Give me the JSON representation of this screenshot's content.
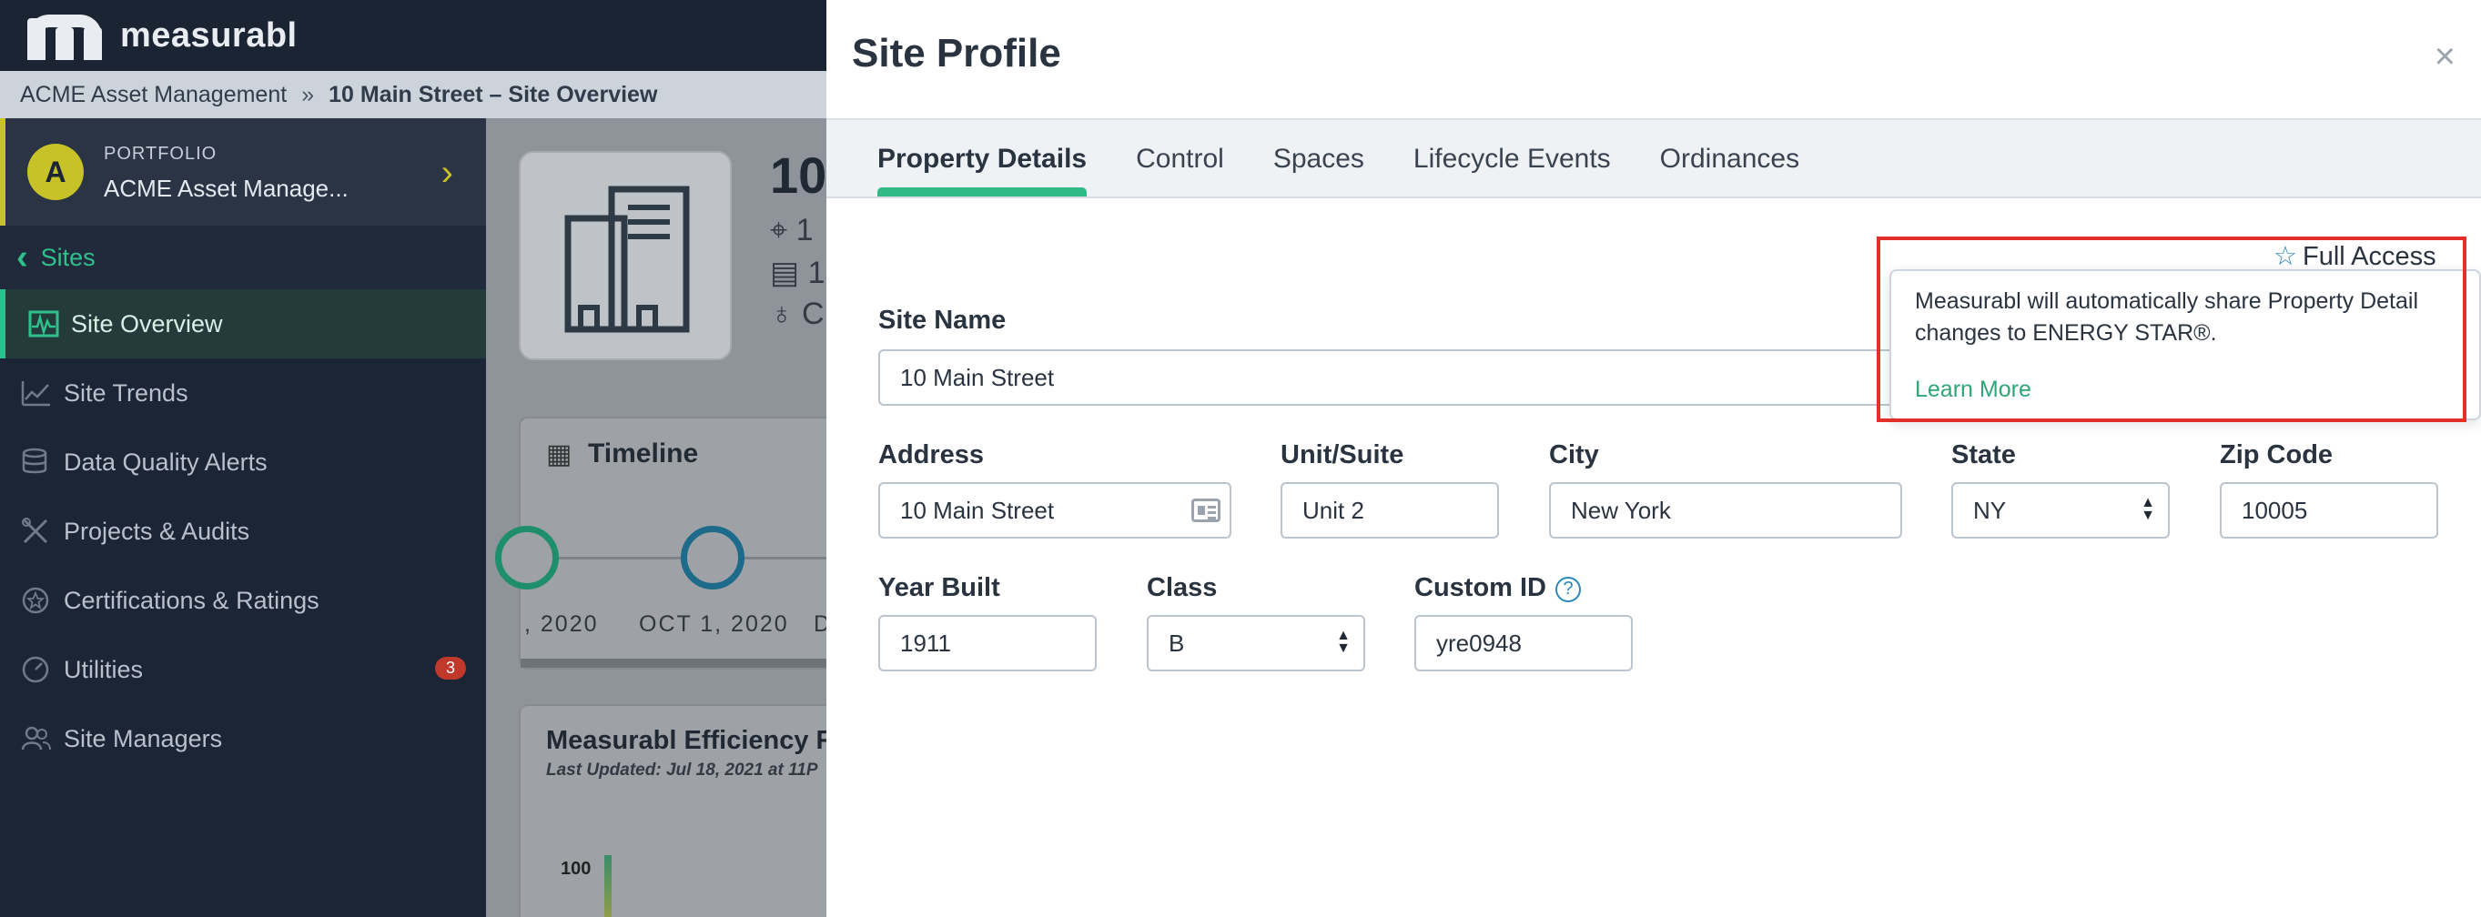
{
  "app": {
    "brand": "measurabl"
  },
  "breadcrumb": {
    "portfolio": "ACME Asset Management",
    "separator": "»",
    "current": "10 Main Street – Site Overview"
  },
  "sidebar": {
    "portfolio_label": "PORTFOLIO",
    "portfolio_name": "ACME Asset Manage...",
    "avatar_letter": "A",
    "sites_label": "Sites",
    "items": [
      {
        "label": "Site Overview",
        "icon": "pulse-chart-icon",
        "active": true
      },
      {
        "label": "Site Trends",
        "icon": "trend-line-icon"
      },
      {
        "label": "Data Quality Alerts",
        "icon": "database-icon"
      },
      {
        "label": "Projects & Audits",
        "icon": "tools-icon"
      },
      {
        "label": "Certifications & Ratings",
        "icon": "star-badge-icon"
      },
      {
        "label": "Utilities",
        "icon": "gauge-icon",
        "badge": "3"
      },
      {
        "label": "Site Managers",
        "icon": "users-icon"
      }
    ]
  },
  "background": {
    "site_title": "10",
    "meta": [
      "1",
      "1",
      "C"
    ],
    "timeline_title": "Timeline",
    "timeline_dates": [
      ", 2020",
      "OCT 1, 2020",
      "D"
    ],
    "efficiency_title": "Measurabl Efficiency R",
    "efficiency_updated": "Last Updated: Jul 18, 2021 at 11P",
    "efficiency_axis": "100"
  },
  "modal": {
    "title": "Site Profile",
    "close": "×",
    "tabs": [
      "Property Details",
      "Control",
      "Spaces",
      "Lifecycle Events",
      "Ordinances"
    ],
    "access": {
      "icon": "☆",
      "label": "Full Access"
    },
    "popover": {
      "text": "Measurabl will automatically share Property Detail changes to ENERGY STAR®.",
      "link": "Learn More"
    },
    "fields": {
      "site_name": {
        "label": "Site Name",
        "value": "10 Main Street"
      },
      "address": {
        "label": "Address",
        "value": "10 Main Street"
      },
      "unit": {
        "label": "Unit/Suite",
        "value": "Unit 2"
      },
      "city": {
        "label": "City",
        "value": "New York"
      },
      "state": {
        "label": "State",
        "value": "NY"
      },
      "zip": {
        "label": "Zip Code",
        "value": "10005"
      },
      "year_built": {
        "label": "Year Built",
        "value": "1911"
      },
      "class": {
        "label": "Class",
        "value": "B"
      },
      "custom_id": {
        "label": "Custom ID",
        "value": "yre0948",
        "help": "?"
      }
    }
  },
  "colors": {
    "accent": "#2fba86",
    "highlight": "#e3302a",
    "sidebar": "#1c2535",
    "link": "#2a8ab8"
  }
}
